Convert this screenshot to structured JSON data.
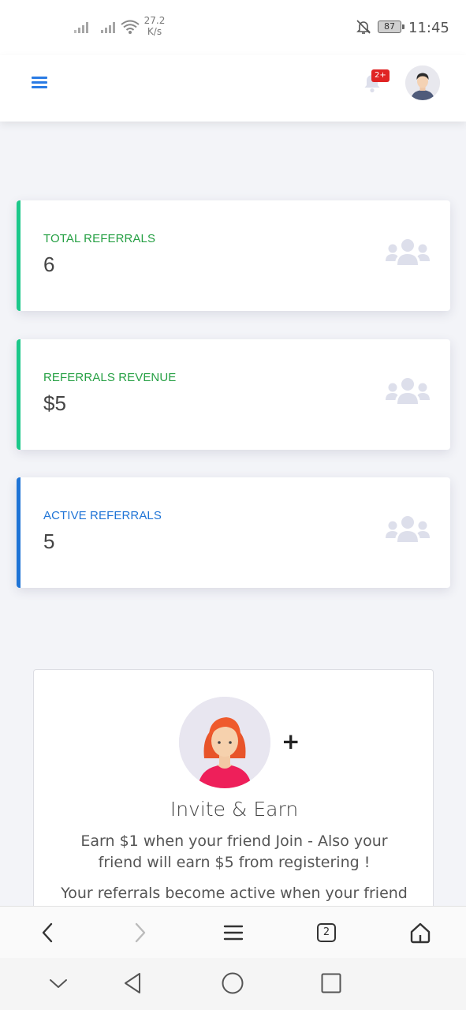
{
  "status_bar": {
    "speed_value": "27.2",
    "speed_unit": "K/s",
    "battery": "87",
    "time": "11:45",
    "icons": [
      "signal-icon",
      "signal-icon",
      "wifi-icon",
      "bell-off-icon",
      "battery-icon"
    ]
  },
  "header": {
    "notification_badge": "2+",
    "icons": [
      "menu-icon",
      "bell-icon",
      "user-avatar"
    ]
  },
  "stats": [
    {
      "label": "TOTAL REFERRALS",
      "value": "6",
      "accent": "#1cc88a",
      "label_color": "#26a044"
    },
    {
      "label": "REFERRALS REVENUE",
      "value": "$5",
      "accent": "#1cc88a",
      "label_color": "#26a044"
    },
    {
      "label": "ACTIVE REFERRALS",
      "value": "5",
      "accent": "#1f74d6",
      "label_color": "#1f74d6"
    }
  ],
  "invite": {
    "plus": "+",
    "title": "Invite & Earn",
    "description": "Earn $1 when your friend Join - Also your friend will earn $5 from registering !",
    "note": "Your referrals become active when your friend"
  },
  "browser_bar": {
    "tab_count": "2",
    "icons": [
      "back-icon",
      "forward-icon",
      "menu-icon",
      "tabs-icon",
      "home-icon"
    ]
  },
  "system_nav": {
    "icons": [
      "collapse-icon",
      "nav-back-icon",
      "nav-home-icon",
      "nav-recents-icon"
    ]
  },
  "colors": {
    "green": "#1cc88a",
    "blue": "#1f74d6",
    "badge": "#e02424",
    "icon_gray": "#dddfeb"
  }
}
